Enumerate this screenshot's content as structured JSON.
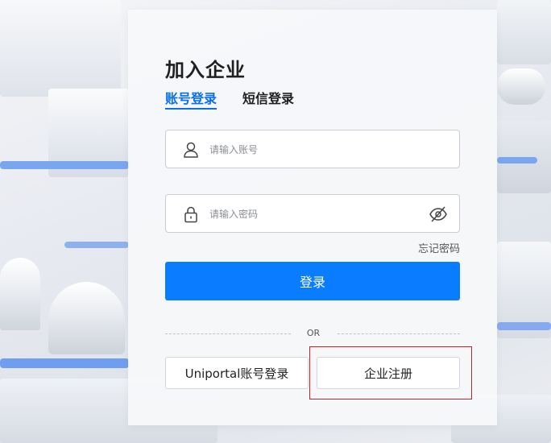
{
  "page": {
    "title": "加入企业"
  },
  "tabs": {
    "account_label": "账号登录",
    "sms_label": "短信登录",
    "active": "account"
  },
  "form": {
    "account_placeholder": "请输入账号",
    "password_placeholder": "请输入密码",
    "forgot_label": "忘记密码",
    "login_label": "登录"
  },
  "alternatives": {
    "or_label": "OR",
    "uniportal_label": "Uniportal账号登录",
    "register_label": "企业注册"
  },
  "icons": {
    "account": "user-icon",
    "password": "lock-icon",
    "toggle": "eye-off-icon"
  },
  "colors": {
    "accent": "#0a7cff",
    "tab_active": "#0a6fea",
    "highlight_box": "#c0252b"
  }
}
